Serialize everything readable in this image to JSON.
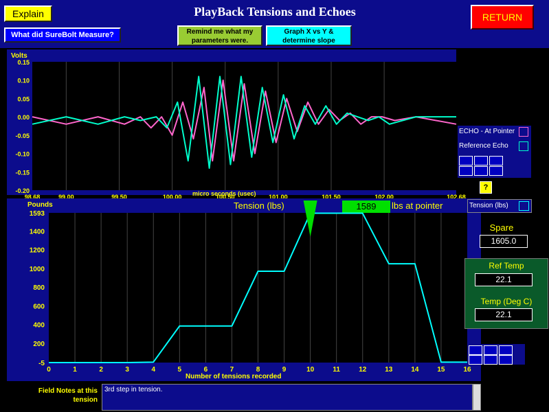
{
  "header": {
    "title": "PlayBack Tensions and Echoes",
    "explain_label": "Explain",
    "measure_label": "What did SureBolt Measure?",
    "remind_label": "Remind me what my parameters were.",
    "graph_label": "Graph X vs Y & determine slope",
    "return_label": "RETURN"
  },
  "echo_panel": {
    "y_title": "Volts",
    "x_title": "micro seconds (usec)",
    "legend": [
      {
        "label": "ECHO - At Pointer",
        "color": "#ff66cc"
      },
      {
        "label": "Reference Echo",
        "color": "#00ffcc"
      }
    ],
    "help_label": "?"
  },
  "tension_panel": {
    "y_title": "Pounds",
    "x_title": "Number of tensions recorded",
    "title": "Tension (lbs)",
    "pointer_value": "1589",
    "pointer_suffix": "lbs at pointer",
    "legend_label": "Tension (lbs)"
  },
  "sidebar": {
    "spare_label": "Spare",
    "spare_value": "1605.0",
    "ref_temp_label": "Ref Temp",
    "ref_temp_value": "22.1",
    "temp_label": "Temp (Deg C)",
    "temp_value": "22.1"
  },
  "notes": {
    "label": "Field Notes at this tension",
    "text": "3rd step in tension."
  },
  "chart_data": [
    {
      "type": "line",
      "x_ticks": [
        "98.68",
        "99.00",
        "99.50",
        "100.00",
        "100.50",
        "101.00",
        "101.50",
        "102.00",
        "102.68"
      ],
      "y_ticks": [
        "0.15",
        "0.10",
        "0.05",
        "0.00",
        "-0.05",
        "-0.10",
        "-0.15",
        "-0.20"
      ],
      "xlim": [
        98.68,
        102.68
      ],
      "ylim": [
        -0.2,
        0.15
      ],
      "series": [
        {
          "name": "ECHO - At Pointer",
          "color": "#ff66cc",
          "x": [
            98.68,
            99.0,
            99.3,
            99.55,
            99.7,
            99.8,
            99.9,
            100.0,
            100.1,
            100.2,
            100.3,
            100.38,
            100.48,
            100.58,
            100.68,
            100.78,
            100.88,
            100.98,
            101.08,
            101.18,
            101.28,
            101.38,
            101.48,
            101.58,
            101.68,
            101.78,
            101.88,
            101.98,
            102.1,
            102.3,
            102.68
          ],
          "y": [
            0.0,
            -0.02,
            0.0,
            -0.02,
            0.0,
            -0.03,
            0.0,
            -0.05,
            0.04,
            -0.06,
            0.08,
            -0.12,
            0.1,
            -0.12,
            0.09,
            -0.1,
            0.07,
            -0.07,
            0.05,
            -0.04,
            0.04,
            -0.02,
            0.02,
            -0.01,
            0.01,
            -0.02,
            0.0,
            0.0,
            -0.01,
            0.0,
            -0.02
          ]
        },
        {
          "name": "Reference Echo",
          "color": "#00ffcc",
          "x": [
            98.68,
            99.0,
            99.3,
            99.55,
            99.7,
            99.85,
            99.95,
            100.05,
            100.15,
            100.25,
            100.35,
            100.45,
            100.55,
            100.65,
            100.75,
            100.85,
            100.95,
            101.05,
            101.15,
            101.25,
            101.35,
            101.45,
            101.55,
            101.65,
            101.75,
            101.85,
            101.95,
            102.05,
            102.3,
            102.68
          ],
          "y": [
            -0.02,
            0.0,
            -0.02,
            0.0,
            -0.01,
            0.0,
            -0.03,
            0.04,
            -0.12,
            0.11,
            -0.14,
            0.11,
            -0.13,
            0.11,
            -0.11,
            0.08,
            -0.07,
            0.06,
            -0.06,
            0.03,
            -0.02,
            0.03,
            -0.02,
            0.01,
            0.0,
            -0.01,
            0.0,
            -0.02,
            0.0,
            0.0
          ]
        }
      ]
    },
    {
      "type": "line",
      "x_ticks": [
        "0",
        "1",
        "2",
        "3",
        "4",
        "5",
        "6",
        "7",
        "8",
        "9",
        "10",
        "11",
        "12",
        "13",
        "14",
        "15",
        "16"
      ],
      "y_ticks": [
        "1593",
        "1400",
        "1200",
        "1000",
        "800",
        "600",
        "400",
        "200",
        "-5"
      ],
      "xlim": [
        0,
        16
      ],
      "ylim": [
        -5,
        1593
      ],
      "series": [
        {
          "name": "Tension (lbs)",
          "color": "#00ffff",
          "x": [
            0,
            1,
            2,
            3,
            4,
            5,
            6,
            7,
            8,
            9,
            10,
            11,
            12,
            13,
            14,
            15,
            16
          ],
          "y": [
            -5,
            -5,
            -5,
            -5,
            0,
            385,
            385,
            385,
            970,
            970,
            1589,
            1589,
            1589,
            1050,
            1050,
            0,
            0
          ]
        }
      ]
    }
  ]
}
